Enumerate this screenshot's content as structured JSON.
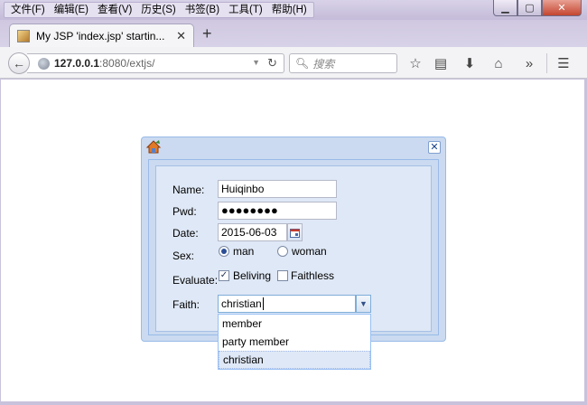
{
  "menubar": [
    "文件(F)",
    "编辑(E)",
    "查看(V)",
    "历史(S)",
    "书签(B)",
    "工具(T)",
    "帮助(H)"
  ],
  "tab": {
    "title": "My JSP 'index.jsp' startin..."
  },
  "address": {
    "host": "127.0.0.1",
    "rest": ":8080/extjs/"
  },
  "search": {
    "placeholder": "搜索"
  },
  "form": {
    "name_label": "Name:",
    "name_value": "Huiqinbo",
    "pwd_label": "Pwd:",
    "pwd_value": "●●●●●●●●",
    "date_label": "Date:",
    "date_value": "2015-06-03",
    "sex_label": "Sex:",
    "sex_options": [
      "man",
      "woman"
    ],
    "sex_selected": "man",
    "evaluate_label": "Evaluate:",
    "evaluate_options": [
      {
        "label": "Beliving",
        "checked": true
      },
      {
        "label": "Faithless",
        "checked": false
      }
    ],
    "faith_label": "Faith:",
    "faith_value": "christian",
    "faith_options": [
      "member",
      "party member",
      "christian"
    ],
    "faith_selected": "christian"
  },
  "colors": {
    "ext_border": "#99bbe8",
    "ext_panel": "#dfe8f6",
    "ext_window": "#cbdaf0"
  }
}
